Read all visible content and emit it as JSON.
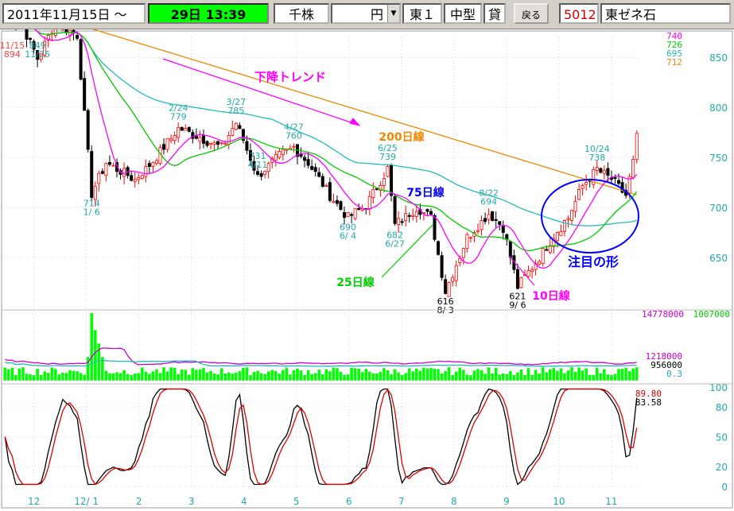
{
  "toolbar": {
    "date": "2011年11月15日 ～",
    "time": "29日 13:39",
    "unit_label": "千株",
    "currency": "円",
    "market": "東１",
    "size": "中型",
    "margin": "貸",
    "back_button": "戻る",
    "code": "5012",
    "name": "東ゼネ石"
  },
  "colors": {
    "bg": "#ffffff",
    "candle_up": "#ff0000",
    "candle_down": "#000000",
    "ma10": "#ff00ff",
    "ma25": "#00cc00",
    "ma75": "#22bbbb",
    "ma200": "#ee8800",
    "volume": "#00ff00",
    "vol_ma_fast": "#cc00cc",
    "vol_ma_slow": "#22bbbb",
    "stoch_k": "#000000",
    "stoch_d": "#dd0000",
    "axis_text": "#22aaaa",
    "highlight": "#0000ff",
    "arrow": "#ff00ff"
  },
  "chart_data": [
    {
      "type": "candlestick",
      "xlabels": [
        "12",
        "12/ 1",
        "2",
        "3",
        "4",
        "5",
        "6",
        "7",
        "8",
        "9",
        "10",
        "11"
      ],
      "ylim": [
        600,
        870
      ],
      "yticks": [
        850,
        800,
        750,
        700,
        650
      ],
      "ma_labels": [
        {
          "name": "ma10",
          "value": "740",
          "color": "#ff00ff"
        },
        {
          "name": "ma25",
          "value": "726",
          "color": "#00cc00"
        },
        {
          "name": "ma75",
          "value": "695",
          "color": "#22bbbb"
        },
        {
          "name": "ma200",
          "value": "712",
          "color": "#ee8800"
        }
      ],
      "annotations": [
        {
          "text": "11/15",
          "text2": "894",
          "color": "#ff4444",
          "x": 2,
          "y": 894
        },
        {
          "text": "849",
          "text2": "11/25",
          "color": "#22aaaa",
          "x": 9,
          "y": 849
        },
        {
          "text": "714",
          "text2": "1/ 6",
          "color": "#22aaaa",
          "x": 24,
          "y": 714
        },
        {
          "text": "2/24",
          "text2": "779",
          "color": "#22aaaa",
          "x": 48,
          "y": 779
        },
        {
          "text": "3/27",
          "text2": "785",
          "color": "#22aaaa",
          "x": 64,
          "y": 785
        },
        {
          "text": "731",
          "text2": "4/11",
          "color": "#22aaaa",
          "x": 70,
          "y": 731
        },
        {
          "text": "4/27",
          "text2": "760",
          "color": "#22aaaa",
          "x": 80,
          "y": 760
        },
        {
          "text": "690",
          "text2": "6/ 4",
          "color": "#22aaaa",
          "x": 95,
          "y": 690
        },
        {
          "text": "6/25",
          "text2": "739",
          "color": "#22aaaa",
          "x": 106,
          "y": 739
        },
        {
          "text": "682",
          "text2": "6/27",
          "color": "#22aaaa",
          "x": 108,
          "y": 682
        },
        {
          "text": "616",
          "text2": "8/ 3",
          "color": "#000000",
          "x": 122,
          "y": 616
        },
        {
          "text": "8/22",
          "text2": "694",
          "color": "#22aaaa",
          "x": 134,
          "y": 694
        },
        {
          "text": "621",
          "text2": "9/ 6",
          "color": "#000000",
          "x": 142,
          "y": 621
        },
        {
          "text": "10/24",
          "text2": "738",
          "color": "#22aaaa",
          "x": 164,
          "y": 738
        }
      ],
      "labels": {
        "trend": "下降トレンド",
        "ma200": "200日線",
        "ma75": "75日線",
        "ma25": "25日線",
        "ma10": "10日線",
        "focus": "注目の形"
      },
      "candles": []
    },
    {
      "type": "bar",
      "name": "volume",
      "top_labels": [
        "14778000",
        "1007000"
      ],
      "right_labels": [
        "1218000",
        "956000",
        "0.3"
      ],
      "values": []
    },
    {
      "type": "line",
      "name": "stochastics",
      "ylim": [
        0,
        100
      ],
      "yticks": [
        100,
        80,
        50,
        20,
        0
      ],
      "value_labels": [
        {
          "value": "89.80",
          "color": "#dd0000"
        },
        {
          "value": "83.58",
          "color": "#000000"
        }
      ],
      "k": [],
      "d": []
    }
  ]
}
